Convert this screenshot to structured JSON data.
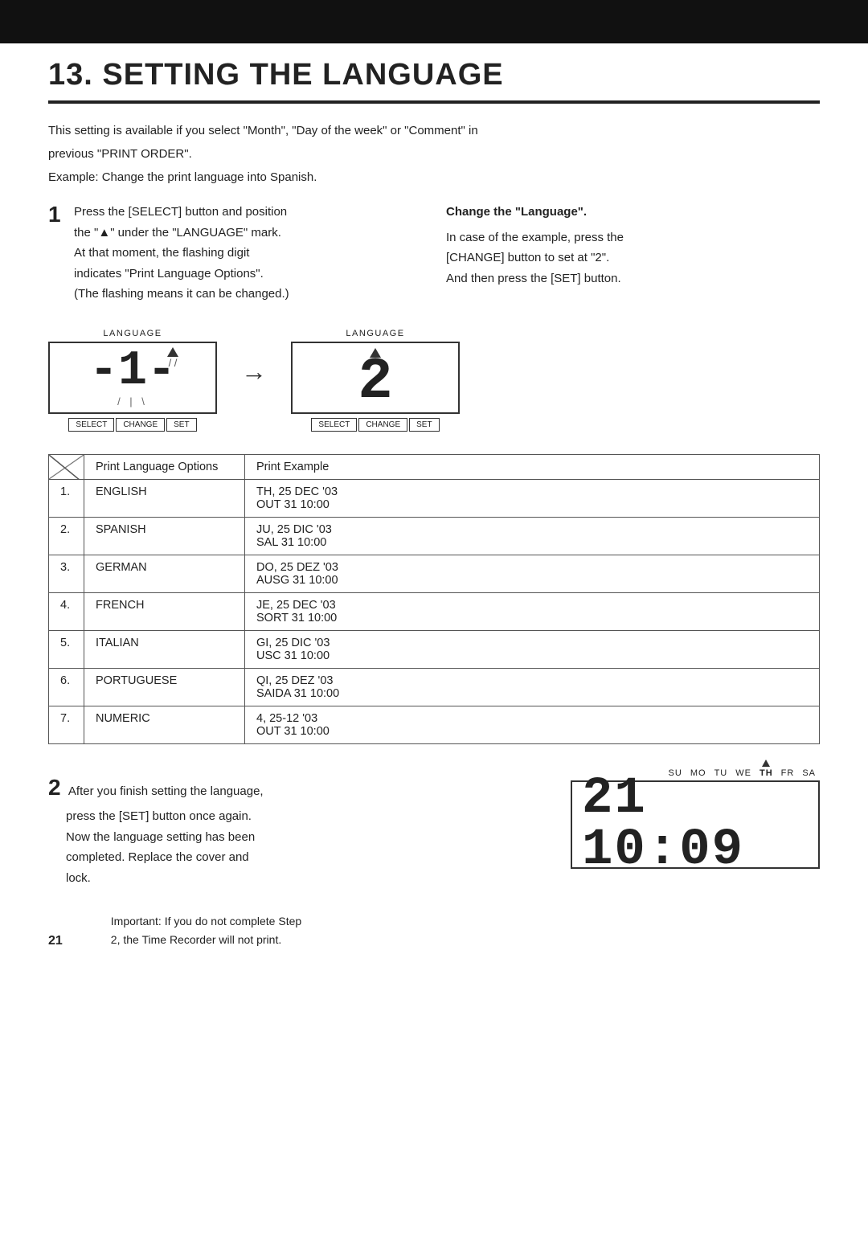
{
  "topBar": {},
  "title": "13. SETTING THE LANGUAGE",
  "intro": {
    "line1": "This setting is available if you select \"Month\", \"Day of the week\" or \"Comment\" in",
    "line2": "previous \"PRINT ORDER\".",
    "line3": "Example: Change the print language into Spanish."
  },
  "step1": {
    "number": "1",
    "left": [
      "Press the [SELECT] button and position",
      "the \"▲\" under the \"LANGUAGE\" mark.",
      "At that moment, the flashing digit",
      "indicates \"Print Language Options\".",
      "(The flashing means it can be changed.)"
    ],
    "right": {
      "title": "Change the \"Language\".",
      "lines": [
        "In  case  of  the  example,  press  the",
        "[CHANGE] button to set at \"2\".",
        "And then press the [SET] button."
      ]
    }
  },
  "displays": {
    "label": "LANGUAGE",
    "display1": {
      "digit": "1",
      "buttons": [
        "SELECT",
        "CHANGE",
        "SET"
      ]
    },
    "arrow": "→",
    "display2": {
      "digit": "2",
      "buttons": [
        "SELECT",
        "CHANGE",
        "SET"
      ]
    }
  },
  "table": {
    "headers": [
      "",
      "Print Language Options",
      "Print Example"
    ],
    "rows": [
      {
        "num": "1.",
        "lang": "ENGLISH",
        "example": "TH, 25 DEC '03\nOUT 31 10:00"
      },
      {
        "num": "2.",
        "lang": "SPANISH",
        "example": "JU, 25 DIC '03\nSAL 31 10:00"
      },
      {
        "num": "3.",
        "lang": "GERMAN",
        "example": "DO, 25 DEZ '03\nAUSG 31 10:00"
      },
      {
        "num": "4.",
        "lang": "FRENCH",
        "example": "JE, 25 DEC '03\nSORT 31 10:00"
      },
      {
        "num": "5.",
        "lang": "ITALIAN",
        "example": "GI, 25 DIC '03\nUSC 31 10:00"
      },
      {
        "num": "6.",
        "lang": "PORTUGUESE",
        "example": "QI, 25 DEZ '03\nSAIDA 31 10:00"
      },
      {
        "num": "7.",
        "lang": "NUMERIC",
        "example": "4, 25-12 '03\nOUT 31 10:00"
      }
    ]
  },
  "step2": {
    "number": "2",
    "lines": [
      "After you finish setting the language,",
      "press the [SET] button once again.",
      "Now the language setting has been",
      "completed. Replace the cover and",
      "lock."
    ],
    "display": {
      "dayLabels": [
        "SU",
        "MO",
        "TU",
        "WE",
        "TH",
        "FR",
        "SA"
      ],
      "digits": "21 10:09"
    }
  },
  "footer": {
    "pageNum": "21",
    "note1": "Important: If you do not complete Step",
    "note2": "2, the Time Recorder will  not print."
  }
}
